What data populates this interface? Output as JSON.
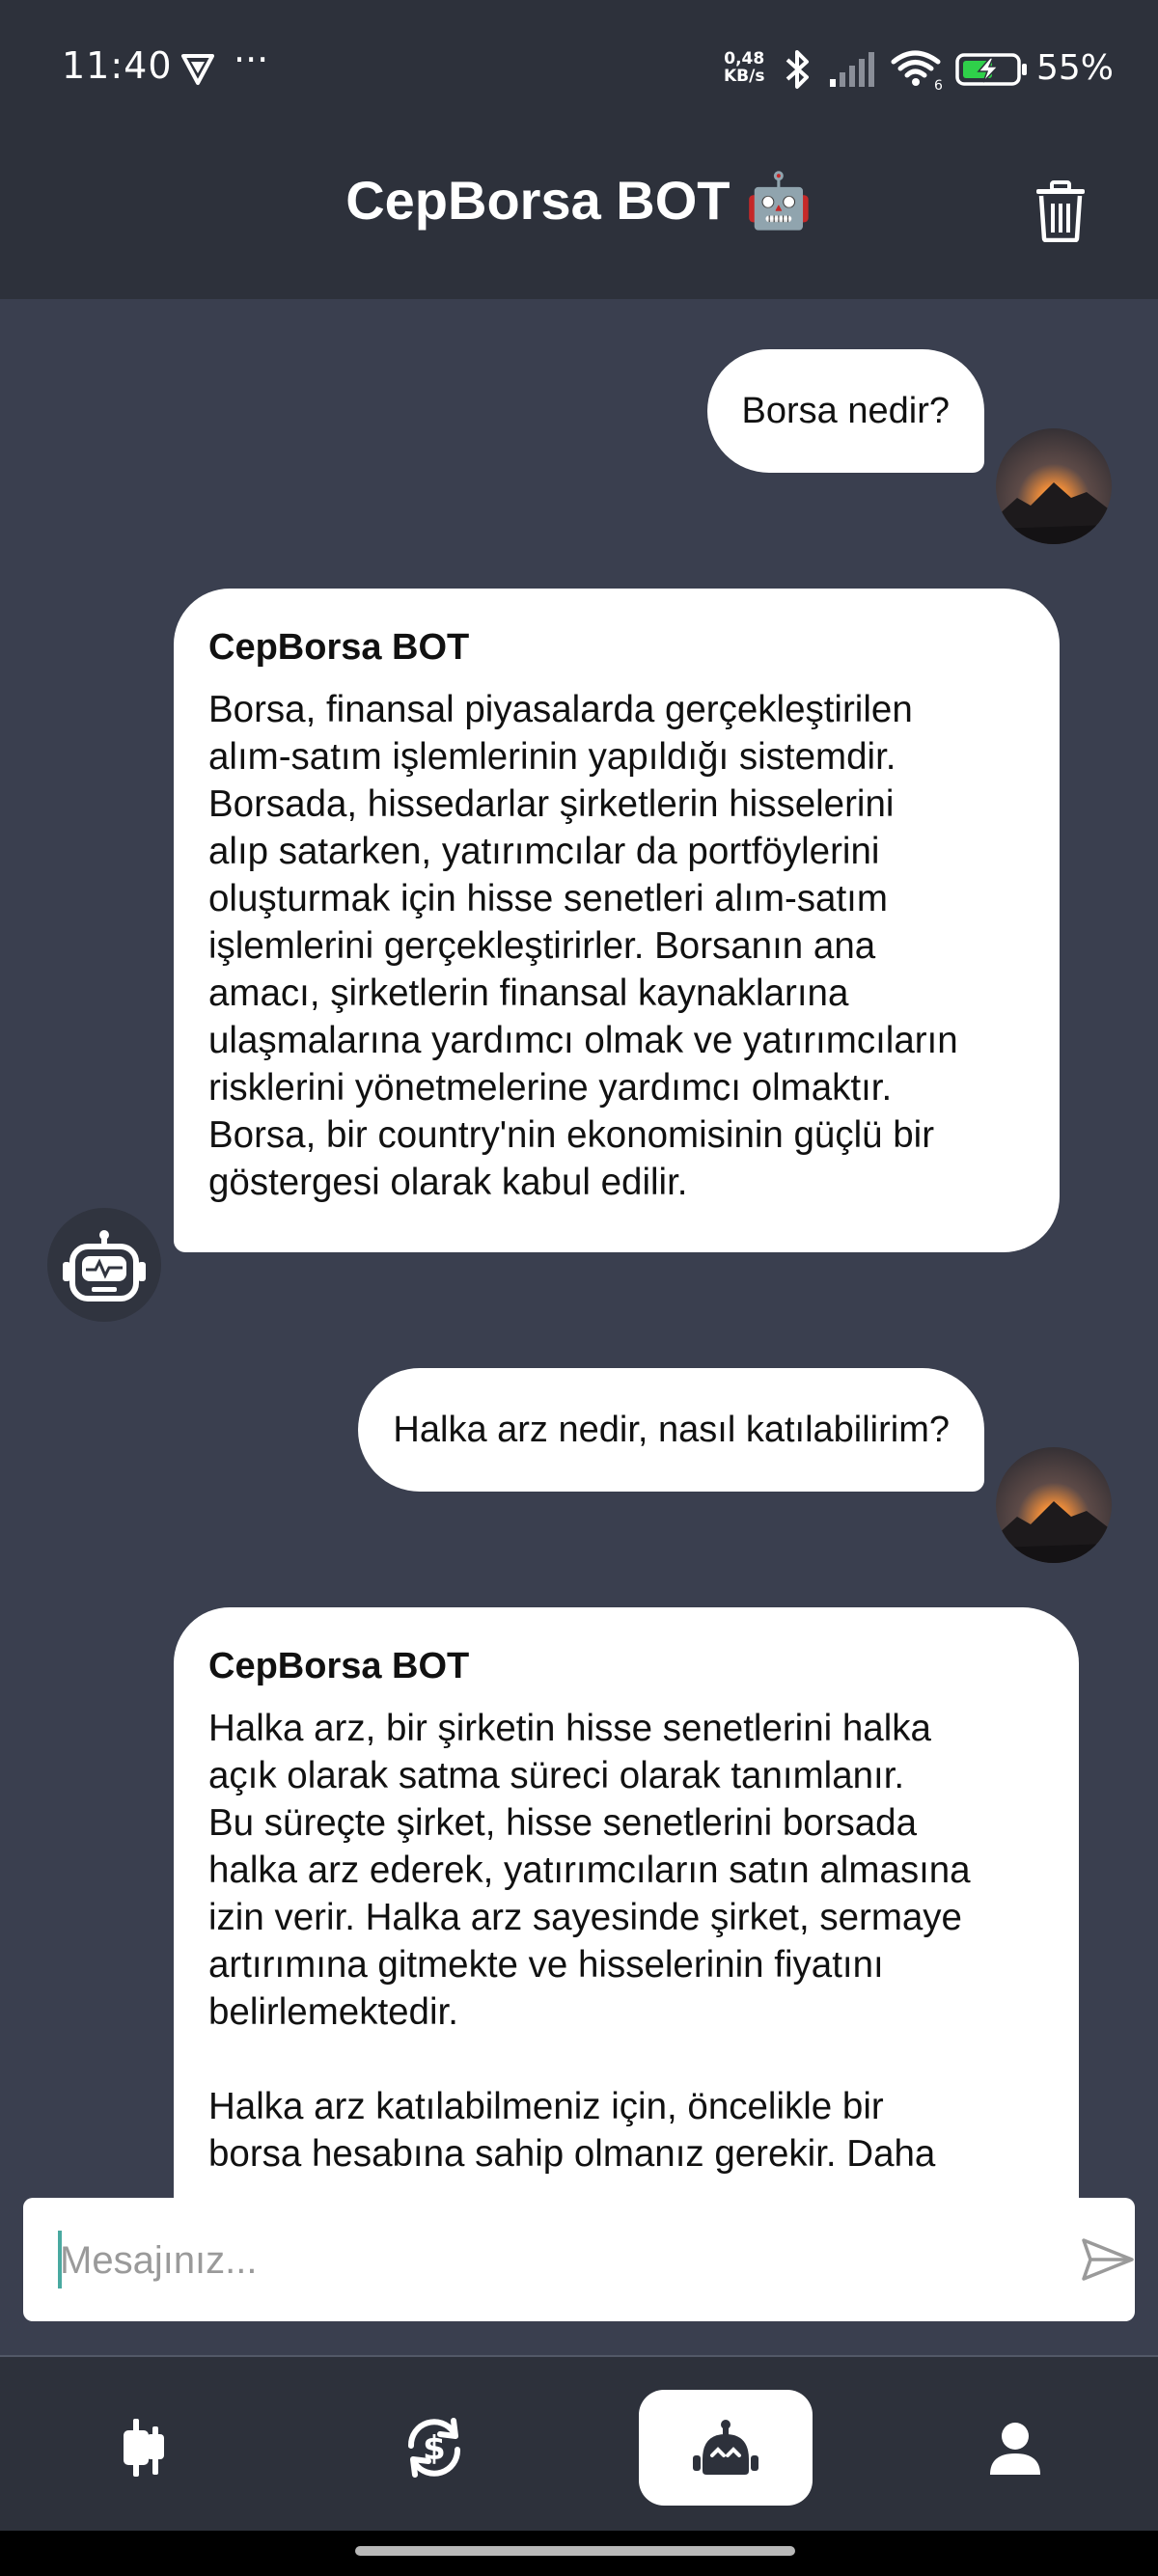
{
  "status_bar": {
    "time": "11:40",
    "dots": "···",
    "net_speed_value": "0,48",
    "net_speed_unit": "KB/s",
    "wifi_label": "6",
    "battery_percent": "55%"
  },
  "header": {
    "title": "CepBorsa BOT 🤖",
    "delete_icon": "trash-icon"
  },
  "messages": [
    {
      "role": "user",
      "text": "Borsa nedir?"
    },
    {
      "role": "bot",
      "name": "CepBorsa BOT",
      "text": "Borsa, finansal piyasalarda gerçekleştirilen\nalım-satım işlemlerinin yapıldığı sistemdir.\nBorsada, hissedarlar şirketlerin hisselerini\nalıp satarken, yatırımcılar da portföylerini\noluşturmak için hisse senetleri alım-satım\nişlemlerini gerçekleştirirler. Borsanın ana\namacı, şirketlerin finansal kaynaklarına\nulaşmalarına yardımcı olmak ve yatırımcıların\nrisklerini yönetmelerine yardımcı olmaktır.\nBorsa, bir country'nin ekonomisinin güçlü bir\ngöstergesi olarak kabul edilir."
    },
    {
      "role": "user",
      "text": "Halka arz nedir, nasıl katılabilirim?"
    },
    {
      "role": "bot",
      "name": "CepBorsa BOT",
      "text": "Halka arz, bir şirketin hisse senetlerini halka\naçık olarak satma süreci olarak tanımlanır.\nBu süreçte şirket, hisse senetlerini borsada\nhalka arz ederek, yatırımcıların satın almasına\nizin verir. Halka arz sayesinde şirket, sermaye\nartırımına gitmekte ve hisselerinin fiyatını\nbelirlemektedir.\n\nHalka arz katılabilmeniz için, öncelikle bir\nborsa hesabına sahip olmanız gerekir. Daha"
    }
  ],
  "input": {
    "placeholder": "Mesajınız...",
    "value": ""
  },
  "nav": [
    {
      "icon": "candlestick-chart-icon",
      "active": false
    },
    {
      "icon": "currency-exchange-icon",
      "active": false
    },
    {
      "icon": "robot-icon",
      "active": true
    },
    {
      "icon": "profile-icon",
      "active": false
    }
  ],
  "colors": {
    "background": "#3a3f4f",
    "bar": "#2d313b",
    "bubble": "#ffffff",
    "accent": "#49a9a0"
  }
}
